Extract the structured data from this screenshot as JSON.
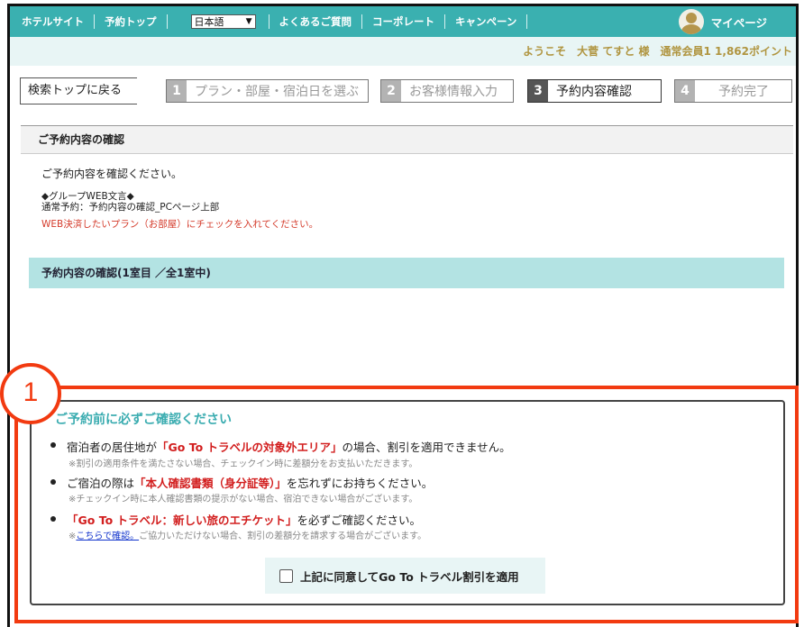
{
  "nav": {
    "items": [
      "ホテルサイト",
      "予約トップ"
    ],
    "language": "日本語",
    "items_right": [
      "よくあるご質問",
      "コーポレート",
      "キャンペーン"
    ],
    "mypage": "マイページ"
  },
  "welcome": "ようこそ　大菅 てすと 様　通常会員1 1,862ポイント",
  "steps": {
    "back": "検索トップに戻る",
    "items": [
      {
        "num": "1",
        "label": "プラン・部屋・宿泊日を選ぶ"
      },
      {
        "num": "2",
        "label": "お客様情報入力"
      },
      {
        "num": "3",
        "label": "予約内容確認"
      },
      {
        "num": "4",
        "label": "予約完了"
      }
    ]
  },
  "confirm": {
    "heading": "ご予約内容の確認",
    "instruction": "ご予約内容を確認ください。",
    "group_label": "◆グループWEB文言◆",
    "group_text": "通常予約：予約内容の確認_PCページ上部",
    "warning": "WEB決済したいプラン（お部屋）にチェックを入れてください。",
    "room_heading": "予約内容の確認(1室目 ／全1室中)"
  },
  "annotation": {
    "badge": "1"
  },
  "notice": {
    "title": "ご予約前に必ずご確認ください",
    "line1_a": "宿泊者の居住地が",
    "line1_em": "「Go To トラベルの対象外エリア」",
    "line1_b": "の場合、割引を適用できません。",
    "line1_sub": "※割引の適用条件を満たさない場合、チェックイン時に差額分をお支払いただきます。",
    "line2_a": "ご宿泊の際は",
    "line2_em": "「本人確認書類（身分証等）」",
    "line2_b": "を忘れずにお持ちください。",
    "line2_sub": "※チェックイン時に本人確認書類の提示がない場合、宿泊できない場合がございます。",
    "line3_em": "「Go To トラベル：新しい旅のエチケット」",
    "line3_b": "を必ずご確認ください。",
    "line3_sub_mark": "※",
    "line3_link": "こちらで確認。",
    "line3_sub": "ご協力いただけない場合、割引の差額分を請求する場合がございます。",
    "agree": "上記に同意してGo To トラベル割引を適用"
  }
}
